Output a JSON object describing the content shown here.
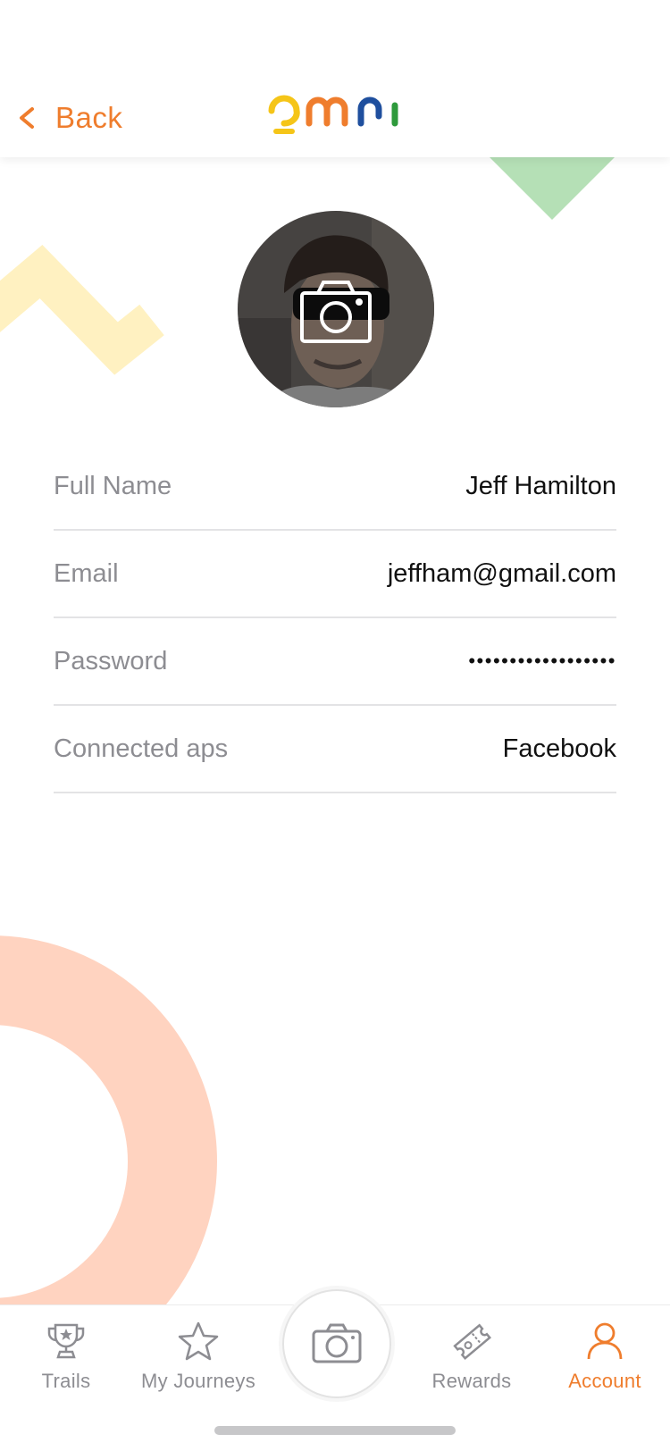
{
  "header": {
    "back_label": "Back",
    "logo_text": "omni",
    "logo_colors": [
      "#f5c518",
      "#ef7d2d",
      "#1f4f9e",
      "#2e9a3c"
    ],
    "accent_color": "#ef7d2d"
  },
  "profile": {
    "avatar_overlay_icon": "camera-icon",
    "fields": [
      {
        "label": "Full Name",
        "value": "Jeff Hamilton"
      },
      {
        "label": "Email",
        "value": "jeffham@gmail.com"
      },
      {
        "label": "Password",
        "value": "••••••••••••••••••"
      },
      {
        "label": "Connected aps",
        "value": "Facebook"
      }
    ]
  },
  "tabbar": {
    "tabs": [
      {
        "label": "Trails",
        "icon": "trophy-icon",
        "active": false
      },
      {
        "label": "My Journeys",
        "icon": "star-icon",
        "active": false
      },
      {
        "label": "Rewards",
        "icon": "ticket-icon",
        "active": false
      },
      {
        "label": "Account",
        "icon": "person-icon",
        "active": true
      }
    ],
    "center_icon": "camera-icon"
  },
  "decoration_colors": {
    "triangle": "#b5e0b6",
    "zigzag": "#fff1c1",
    "arc": "#ffd3c0"
  }
}
